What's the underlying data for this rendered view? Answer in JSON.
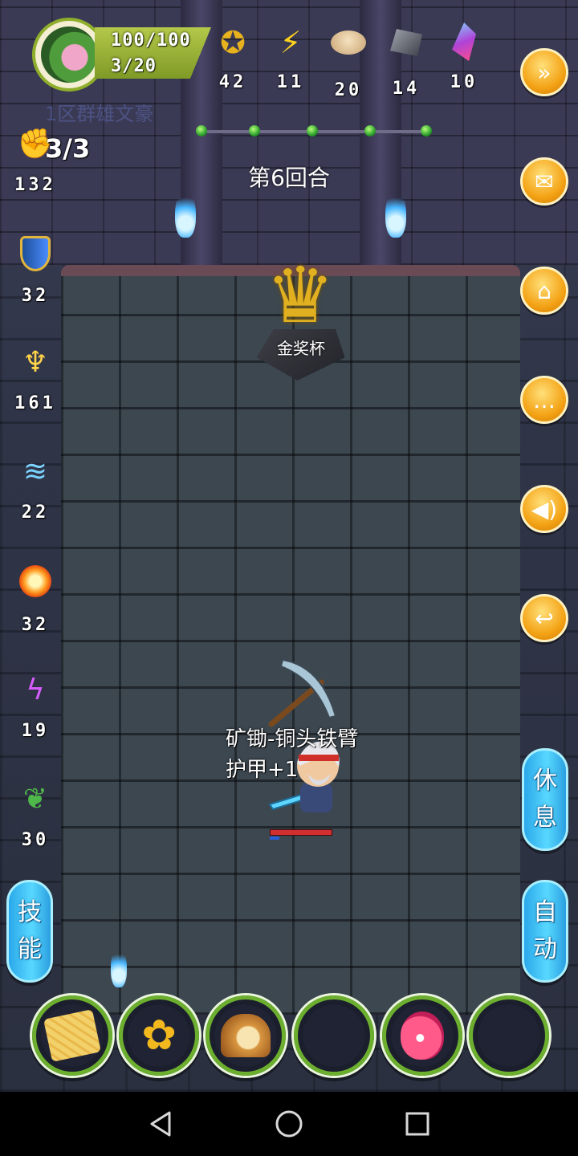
{
  "header": {
    "hp": "100/100",
    "stage": "3/20",
    "zone_label": "1区群雄文豪",
    "resources": [
      {
        "icon": "gold-coin-icon",
        "value": "42"
      },
      {
        "icon": "lightning-icon",
        "value": "11"
      },
      {
        "icon": "bun-icon",
        "value": "20"
      },
      {
        "icon": "iron-ore-icon",
        "value": "14"
      },
      {
        "icon": "crystal-icon",
        "value": "10"
      }
    ],
    "progress_nodes": 5
  },
  "round_label": "第6回合",
  "left_stats": {
    "fist": {
      "icon": "fist-icon",
      "count": "3/3",
      "value": "132"
    },
    "items": [
      {
        "icon": "shield-icon",
        "value": "32"
      },
      {
        "icon": "fire-sword-icon",
        "value": "161"
      },
      {
        "icon": "water-icon",
        "value": "22"
      },
      {
        "icon": "fire-orb-icon",
        "value": "32"
      },
      {
        "icon": "lightning-purple-icon",
        "value": "19"
      },
      {
        "icon": "poison-icon",
        "value": "30"
      }
    ]
  },
  "right_buttons": [
    {
      "name": "fast-forward-button",
      "icon": "fast-forward-icon"
    },
    {
      "name": "mail-button",
      "icon": "mail-icon"
    },
    {
      "name": "home-button",
      "icon": "home-icon"
    },
    {
      "name": "chat-button",
      "icon": "chat-icon"
    },
    {
      "name": "sound-button",
      "icon": "speaker-icon"
    },
    {
      "name": "return-button",
      "icon": "return-icon"
    }
  ],
  "trophy_label": "金奖杯",
  "hero_event": {
    "item_name": "矿锄-铜头铁臂",
    "effect": "护甲+1"
  },
  "buttons": {
    "rest": [
      "休",
      "息"
    ],
    "skill": [
      "技",
      "能"
    ],
    "auto": [
      "自",
      "动"
    ]
  },
  "item_slots": [
    "biscuit-icon",
    "sunflower-icon",
    "bread-icon",
    "empty",
    "potion-icon",
    "empty"
  ],
  "colors": {
    "accent": "#f4a316",
    "pill": "#3fc2f5",
    "slot_border": "#6cae2e"
  }
}
